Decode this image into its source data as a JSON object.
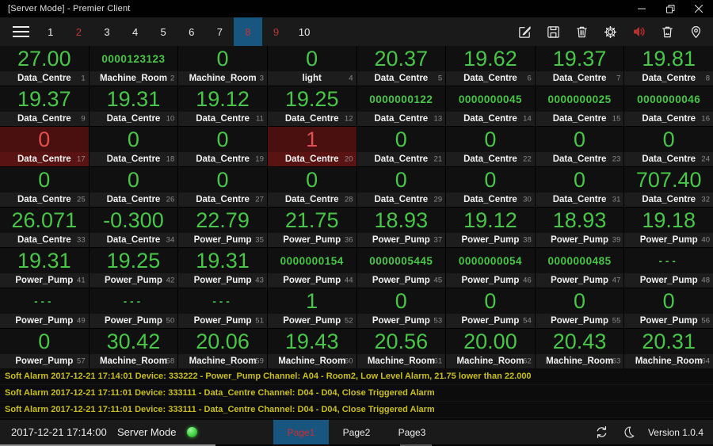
{
  "window": {
    "title": "[Server Mode] - Premier Client"
  },
  "tabbar": {
    "tabs": [
      {
        "label": "1"
      },
      {
        "label": "2",
        "alert": true
      },
      {
        "label": "3"
      },
      {
        "label": "4"
      },
      {
        "label": "5"
      },
      {
        "label": "6"
      },
      {
        "label": "7"
      },
      {
        "label": "8",
        "alert": true,
        "selected": true
      },
      {
        "label": "9",
        "alert": true
      },
      {
        "label": "10"
      }
    ],
    "toolbar_icons": [
      "edit-icon",
      "save-icon",
      "delete-icon",
      "settings-icon",
      "sound-on-icon",
      "clear-screen-icon",
      "location-icon"
    ]
  },
  "grid": {
    "cells": [
      {
        "v": "27.00",
        "l": "Data_Centre",
        "i": 1
      },
      {
        "v": "0000123123",
        "l": "Machine_Room",
        "i": 2,
        "s": true
      },
      {
        "v": "0",
        "l": "Machine_Room",
        "i": 3
      },
      {
        "v": "0",
        "l": "light",
        "i": 4
      },
      {
        "v": "20.37",
        "l": "Data_Centre",
        "i": 5
      },
      {
        "v": "19.62",
        "l": "Data_Centre",
        "i": 6
      },
      {
        "v": "19.37",
        "l": "Data_Centre",
        "i": 7
      },
      {
        "v": "19.81",
        "l": "Data_Centre",
        "i": 8
      },
      {
        "v": "19.37",
        "l": "Data_Centre",
        "i": 9
      },
      {
        "v": "19.31",
        "l": "Data_Centre",
        "i": 10
      },
      {
        "v": "19.12",
        "l": "Data_Centre",
        "i": 11
      },
      {
        "v": "19.25",
        "l": "Data_Centre",
        "i": 12
      },
      {
        "v": "0000000122",
        "l": "Data_Centre",
        "i": 13,
        "s": true
      },
      {
        "v": "0000000045",
        "l": "Data_Centre",
        "i": 14,
        "s": true
      },
      {
        "v": "0000000025",
        "l": "Data_Centre",
        "i": 15,
        "s": true
      },
      {
        "v": "0000000046",
        "l": "Data_Centre",
        "i": 16,
        "s": true
      },
      {
        "v": "0",
        "l": "Data_Centre",
        "i": 17,
        "a": true
      },
      {
        "v": "0",
        "l": "Data_Centre",
        "i": 18
      },
      {
        "v": "0",
        "l": "Data_Centre",
        "i": 19
      },
      {
        "v": "1",
        "l": "Data_Centre",
        "i": 20,
        "a": true
      },
      {
        "v": "0",
        "l": "Data_Centre",
        "i": 21
      },
      {
        "v": "0",
        "l": "Data_Centre",
        "i": 22
      },
      {
        "v": "0",
        "l": "Data_Centre",
        "i": 23
      },
      {
        "v": "0",
        "l": "Data_Centre",
        "i": 24
      },
      {
        "v": "0",
        "l": "Data_Centre",
        "i": 25
      },
      {
        "v": "0",
        "l": "Data_Centre",
        "i": 26
      },
      {
        "v": "0",
        "l": "Data_Centre",
        "i": 27
      },
      {
        "v": "0",
        "l": "Data_Centre",
        "i": 28
      },
      {
        "v": "0",
        "l": "Data_Centre",
        "i": 29
      },
      {
        "v": "0",
        "l": "Data_Centre",
        "i": 30
      },
      {
        "v": "0",
        "l": "Data_Centre",
        "i": 31
      },
      {
        "v": "707.40",
        "l": "Data_Centre",
        "i": 32
      },
      {
        "v": "26.071",
        "l": "Data_Centre",
        "i": 33
      },
      {
        "v": "-0.300",
        "l": "Data_Centre",
        "i": 34
      },
      {
        "v": "22.79",
        "l": "Power_Pump",
        "i": 35
      },
      {
        "v": "21.75",
        "l": "Power_Pump",
        "i": 36
      },
      {
        "v": "18.93",
        "l": "Power_Pump",
        "i": 37
      },
      {
        "v": "19.12",
        "l": "Power_Pump",
        "i": 38
      },
      {
        "v": "18.93",
        "l": "Power_Pump",
        "i": 39
      },
      {
        "v": "19.18",
        "l": "Power_Pump",
        "i": 40
      },
      {
        "v": "19.31",
        "l": "Power_Pump",
        "i": 41
      },
      {
        "v": "19.25",
        "l": "Power_Pump",
        "i": 42
      },
      {
        "v": "19.31",
        "l": "Power_Pump",
        "i": 43
      },
      {
        "v": "0000000154",
        "l": "Power_Pump",
        "i": 44,
        "s": true
      },
      {
        "v": "0000005445",
        "l": "Power_Pump",
        "i": 45,
        "s": true
      },
      {
        "v": "0000000054",
        "l": "Power_Pump",
        "i": 46,
        "s": true
      },
      {
        "v": "0000000485",
        "l": "Power_Pump",
        "i": 47,
        "s": true
      },
      {
        "v": "---",
        "l": "Power_Pump",
        "i": 48,
        "s": true
      },
      {
        "v": "---",
        "l": "Power_Pump",
        "i": 49,
        "s": true
      },
      {
        "v": "---",
        "l": "Power_Pump",
        "i": 50,
        "s": true
      },
      {
        "v": "---",
        "l": "Power_Pump",
        "i": 51,
        "s": true
      },
      {
        "v": "1",
        "l": "Power_Pump",
        "i": 52
      },
      {
        "v": "0",
        "l": "Power_Pump",
        "i": 53
      },
      {
        "v": "0",
        "l": "Power_Pump",
        "i": 54
      },
      {
        "v": "0",
        "l": "Power_Pump",
        "i": 55
      },
      {
        "v": "0",
        "l": "Power_Pump",
        "i": 56
      },
      {
        "v": "0",
        "l": "Power_Pump",
        "i": 57
      },
      {
        "v": "30.42",
        "l": "Machine_Room",
        "i": 58
      },
      {
        "v": "20.06",
        "l": "Machine_Room",
        "i": 59
      },
      {
        "v": "19.43",
        "l": "Machine_Room",
        "i": 60
      },
      {
        "v": "20.56",
        "l": "Machine_Room",
        "i": 61
      },
      {
        "v": "20.00",
        "l": "Machine_Room",
        "i": 62
      },
      {
        "v": "20.43",
        "l": "Machine_Room",
        "i": 63
      },
      {
        "v": "20.31",
        "l": "Machine_Room",
        "i": 64
      }
    ]
  },
  "alarm_log": {
    "messages": [
      "Soft Alarm 2017-12-21 17:14:01 Device: 333222 - Power_Pump Channel: A04 - Room2, Low Level Alarm, 21.75 lower than 22.000",
      "Soft Alarm 2017-12-21 17:11:01 Device: 333111 - Data_Centre Channel: D04 - D04, Close Triggered Alarm",
      "Soft Alarm 2017-12-21 17:11:01 Device: 333111 - Data_Centre Channel: D04 - D04, Close Triggered Alarm"
    ]
  },
  "statusbar": {
    "time": "2017-12-21 17:14:00",
    "mode_label": "Server Mode",
    "mode_status": "online",
    "pages": [
      {
        "label": "Page1",
        "selected": true
      },
      {
        "label": "Page2"
      },
      {
        "label": "Page3"
      }
    ],
    "version": "Version 1.0.4"
  },
  "colors": {
    "value_green": "#48c648",
    "value_red": "#e05050",
    "alarm_cell_bg": "#4a0f0f",
    "tab_alert_red": "#c23636",
    "selected_blue": "#18557f",
    "page_selected_red": "#d42c2c",
    "alarm_text_yellow": "#c9be1a",
    "speaker_red": "#b93030",
    "led_green": "#3fd63f"
  }
}
